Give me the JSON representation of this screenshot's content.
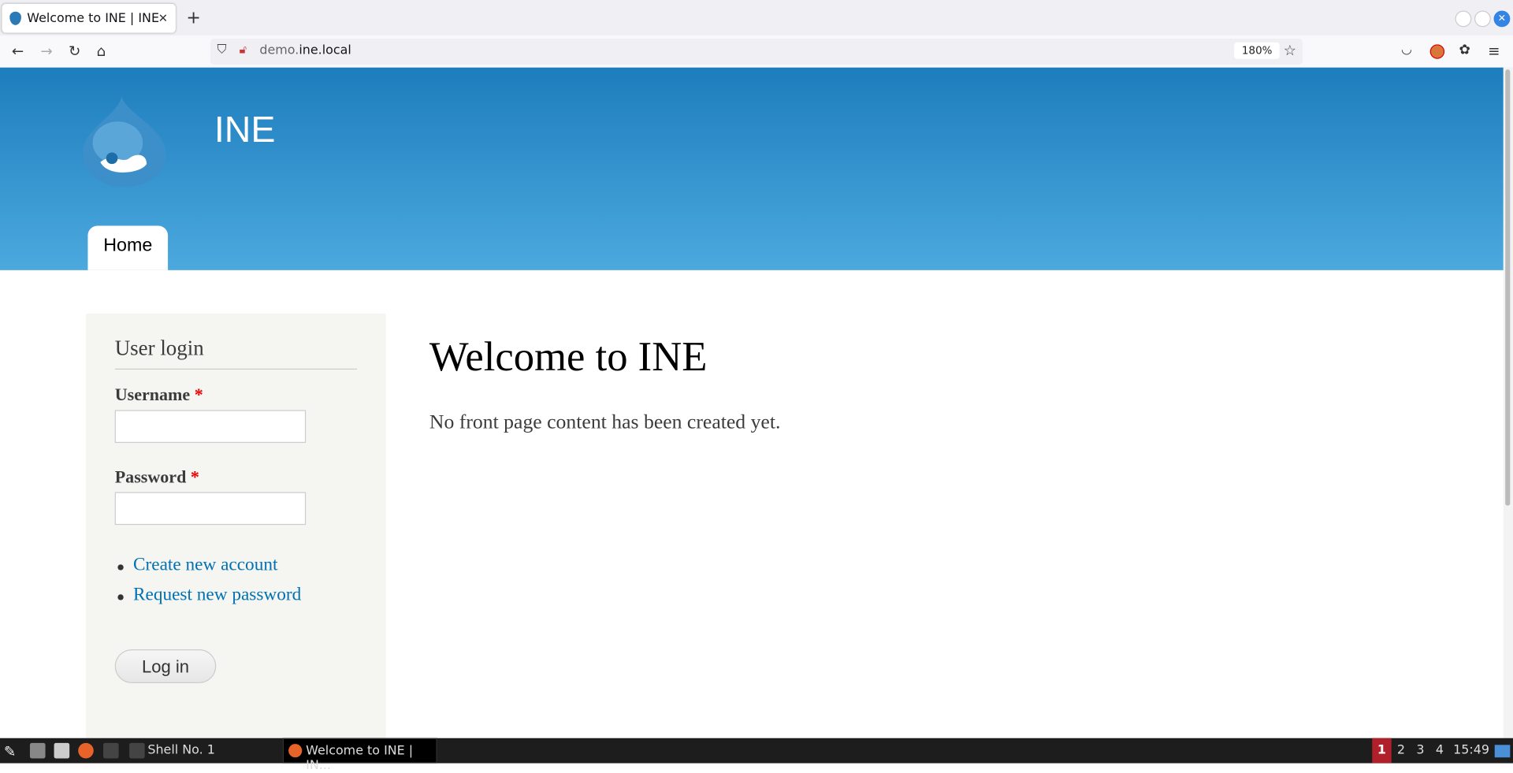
{
  "browser": {
    "tab_title": "Welcome to INE | INE",
    "url_domain_prefix": "demo.",
    "url_domain_main": "ine.local",
    "zoom": "180%"
  },
  "site": {
    "name": "INE",
    "nav": [
      "Home"
    ]
  },
  "login": {
    "title": "User login",
    "username_label": "Username",
    "password_label": "Password",
    "required_mark": "*",
    "username_value": "",
    "password_value": "",
    "links": [
      "Create new account",
      "Request new password"
    ],
    "submit": "Log in"
  },
  "main": {
    "title": "Welcome to INE",
    "text": "No front page content has been created yet."
  },
  "taskbar": {
    "shell": "Shell No. 1",
    "window": "Welcome to INE | IN...",
    "workspaces": [
      "1",
      "2",
      "3",
      "4"
    ],
    "clock": "15:49"
  },
  "colors": {
    "header_top": "#1d7dbd",
    "header_bottom": "#4ca9de",
    "link": "#0071b3",
    "active_workspace": "#b0202a"
  }
}
